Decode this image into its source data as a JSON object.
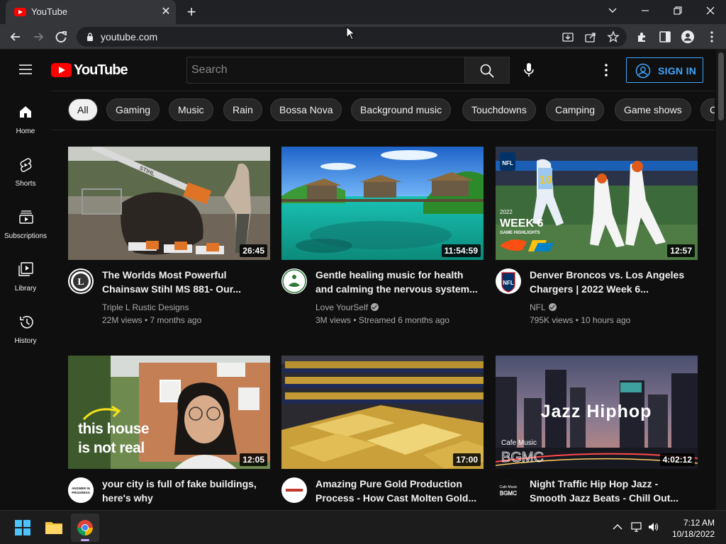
{
  "browser": {
    "tab_title": "YouTube",
    "url": "youtube.com"
  },
  "youtube": {
    "logo_text": "YouTube",
    "search_placeholder": "Search",
    "sign_in": "SIGN IN",
    "sidebar": [
      {
        "label": "Home",
        "icon": "home-icon"
      },
      {
        "label": "Shorts",
        "icon": "shorts-icon"
      },
      {
        "label": "Subscriptions",
        "icon": "subscriptions-icon"
      },
      {
        "label": "Library",
        "icon": "library-icon"
      },
      {
        "label": "History",
        "icon": "history-icon"
      }
    ],
    "chips": [
      "All",
      "Gaming",
      "Music",
      "Rain",
      "Bossa Nova",
      "Background music",
      "Touchdowns",
      "Camping",
      "Game shows",
      "C"
    ],
    "videos": [
      {
        "title1": "The Worlds Most Powerful",
        "title2": "Chainsaw Stihl MS 881- Our...",
        "channel": "Triple L Rustic Designs",
        "verified": false,
        "meta": "22M views • 7 months ago",
        "duration": "26:45"
      },
      {
        "title1": "Gentle healing music for health",
        "title2": "and calming the nervous system...",
        "channel": "Love YourSelf",
        "verified": true,
        "meta": "3M views • Streamed 6 months ago",
        "duration": "11:54:59"
      },
      {
        "title1": "Denver Broncos vs. Los Angeles",
        "title2": "Chargers | 2022 Week 6...",
        "channel": "NFL",
        "verified": true,
        "meta": "795K views • 10 hours ago",
        "duration": "12:57"
      },
      {
        "title1": "your city is full of fake buildings,",
        "title2": "here's why",
        "channel": "",
        "verified": false,
        "meta": "",
        "duration": "12:05"
      },
      {
        "title1": "Amazing Pure Gold Production",
        "title2": "Process - How Cast Molten Gold...",
        "channel": "",
        "verified": false,
        "meta": "",
        "duration": "17:00"
      },
      {
        "title1": "Night Traffic Hip Hop Jazz -",
        "title2": "Smooth Jazz Beats - Chill Out...",
        "channel": "",
        "verified": false,
        "meta": "",
        "duration": "4:02:12"
      }
    ],
    "thumb_text": {
      "week6_line1": "2022",
      "week6_line2": "WEEK 6",
      "week6_line3": "GAME HIGHLIGHTS",
      "house_line1": "this house",
      "house_line2": "is not real",
      "jazz_title": "Jazz Hiphop",
      "jazz_sub1": "Cafe Music",
      "jazz_sub2": "BGMC",
      "nfl": "NFL",
      "stihl": "STIHL"
    },
    "avatar_text": {
      "nfl": "NFL",
      "answer": "ANSWER IN PROGRESS",
      "jazz1": "Cafe Music",
      "jazz2": "BGMC"
    }
  },
  "taskbar": {
    "time": "7:12 AM",
    "date": "10/18/2022"
  },
  "colors": {
    "accent_blue": "#3ea6ff",
    "youtube_red": "#ff0000",
    "background": "#0f0f0f"
  }
}
